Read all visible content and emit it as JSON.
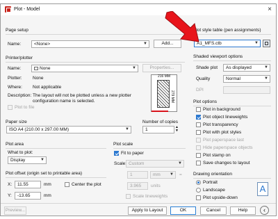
{
  "window": {
    "title": "Plot - Model",
    "close_glyph": "×"
  },
  "page_setup": {
    "heading": "Page setup",
    "name_label": "Name:",
    "name_value": "<None>",
    "add_button": "Add..."
  },
  "printer": {
    "heading": "Printer/plotter",
    "name_label": "Name:",
    "name_value": "None",
    "properties_button": "Properties...",
    "plotter_label": "Plotter:",
    "plotter_value": "None",
    "where_label": "Where:",
    "where_value": "Not applicable",
    "description_label": "Description:",
    "description_line1": "The layout will not be plotted unless a new plotter",
    "description_line2": "configuration name is selected.",
    "plot_to_file": "Plot to file",
    "preview_top": "216 MM",
    "preview_side": "279 MM"
  },
  "paper_size": {
    "heading": "Paper size",
    "value": "ISO A4 (210.00 x 297.00 MM)"
  },
  "copies": {
    "heading": "Number of copies",
    "value": "1"
  },
  "plot_area": {
    "heading": "Plot area",
    "what_label": "What to plot:",
    "what_value": "Display"
  },
  "plot_offset": {
    "heading": "Plot offset (origin set to printable area)",
    "x_label": "X:",
    "x_value": "11.55",
    "x_unit": "mm",
    "y_label": "Y:",
    "y_value": "-13.65",
    "y_unit": "mm",
    "center_label": "Center the plot"
  },
  "plot_scale": {
    "heading": "Plot scale",
    "fit_label": "Fit to paper",
    "scale_label": "Scale:",
    "scale_value": "Custom",
    "num_value": "1",
    "num_unit": "mm",
    "equals": "=",
    "den_value": "3.965",
    "den_unit": "units",
    "lineweights_label": "Scale lineweights"
  },
  "style_table": {
    "heading": "Plot style table (pen assignments)",
    "value": "A1_MFS.ctb"
  },
  "shaded": {
    "heading": "Shaded viewport options",
    "shade_label": "Shade plot",
    "shade_value": "As displayed",
    "quality_label": "Quality",
    "quality_value": "Normal",
    "dpi_label": "DPI"
  },
  "plot_options": {
    "heading": "Plot options",
    "items": [
      {
        "label": "Plot in background",
        "checked": false,
        "enabled": true
      },
      {
        "label": "Plot object lineweights",
        "checked": true,
        "enabled": true
      },
      {
        "label": "Plot transparency",
        "checked": false,
        "enabled": true
      },
      {
        "label": "Plot with plot styles",
        "checked": false,
        "enabled": true
      },
      {
        "label": "Plot paperspace last",
        "checked": false,
        "enabled": false
      },
      {
        "label": "Hide paperspace objects",
        "checked": false,
        "enabled": false
      },
      {
        "label": "Plot stamp on",
        "checked": false,
        "enabled": true
      },
      {
        "label": "Save changes to layout",
        "checked": false,
        "enabled": true
      }
    ]
  },
  "orientation": {
    "heading": "Drawing orientation",
    "portrait": "Portrait",
    "landscape": "Landscape",
    "upside_down": "Plot upside-down",
    "icon_letter": "A"
  },
  "footer": {
    "preview": "Preview...",
    "apply": "Apply to Layout",
    "ok": "OK",
    "cancel": "Cancel",
    "help": "Help",
    "collapse_glyph": "‹"
  },
  "colors": {
    "arrow": "#e8141b",
    "accent": "#2b78d0",
    "warning": "#d8111a"
  }
}
